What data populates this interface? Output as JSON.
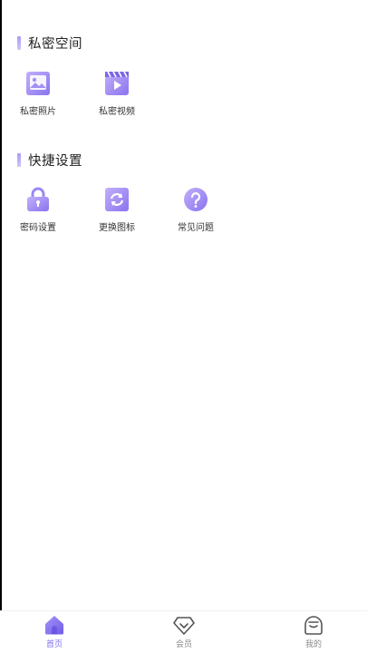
{
  "sections": [
    {
      "title": "私密空间",
      "items": [
        {
          "label": "私密照片",
          "icon": "photo-icon"
        },
        {
          "label": "私密视频",
          "icon": "video-icon"
        }
      ]
    },
    {
      "title": "快捷设置",
      "items": [
        {
          "label": "密码设置",
          "icon": "lock-icon"
        },
        {
          "label": "更换图标",
          "icon": "swap-icon"
        },
        {
          "label": "常见问题",
          "icon": "help-icon"
        }
      ]
    }
  ],
  "tabbar": {
    "items": [
      {
        "label": "首页",
        "icon": "home-icon",
        "active": true
      },
      {
        "label": "会员",
        "icon": "vip-icon",
        "active": false
      },
      {
        "label": "我的",
        "icon": "profile-icon",
        "active": false
      }
    ]
  },
  "colors": {
    "accent": "#7b6ff0",
    "icon_gradient_start": "#b9a6f9",
    "icon_gradient_end": "#8a73ee",
    "tab_inactive": "#8a8a8a"
  }
}
